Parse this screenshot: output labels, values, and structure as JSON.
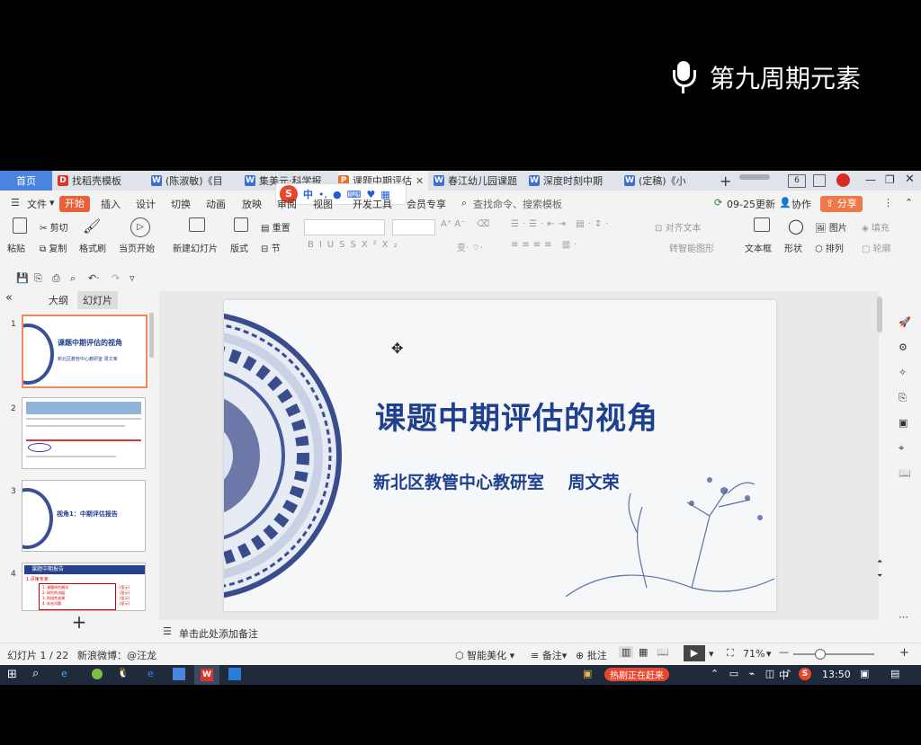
{
  "overlay": {
    "title": "第九周期元素"
  },
  "tabs": {
    "home": "首页",
    "items": [
      {
        "label": "找稻壳模板"
      },
      {
        "label": "(陈淑敏)《目"
      },
      {
        "label": "集美元·科学报"
      },
      {
        "label": "课题中期评估"
      },
      {
        "label": "春江幼儿园课题"
      },
      {
        "label": "深度时刻中期"
      },
      {
        "label": "(定稿)《小"
      }
    ],
    "new_tab": "+",
    "window_badge": "6"
  },
  "menu": {
    "file": "文件",
    "start": "开始",
    "items": [
      "插入",
      "设计",
      "切换",
      "动画",
      "放映",
      "审阅",
      "视图",
      "开发工具",
      "会员专享"
    ],
    "search_placeholder": "查找命令、搜索模板",
    "update": "09-25更新",
    "collab": "协作",
    "share": "分享"
  },
  "ime": {
    "label": "中"
  },
  "ribbon": {
    "paste": "粘贴",
    "cut": "剪切",
    "copy": "复制",
    "format_painter": "格式刷",
    "from_current": "当页开始",
    "new_slide": "新建幻灯片",
    "layout": "版式",
    "reset": "重置",
    "section": "节",
    "align_text": "对齐文本",
    "smartart": "转智能图形",
    "textbox": "文本框",
    "shape": "形状",
    "picture": "图片",
    "arrange": "排列",
    "fill": "填充",
    "outline": "轮廓"
  },
  "left_panel": {
    "tab_outline": "大纲",
    "tab_slides": "幻灯片",
    "add": "+"
  },
  "thumbs": [
    {
      "num": "1",
      "title": "课题中期评估的视角",
      "sub": "新北区教管中心教研室  周文荣"
    },
    {
      "num": "2"
    },
    {
      "num": "3",
      "title": "视角1：中期评估报告"
    },
    {
      "num": "4",
      "title": "课题中期报告",
      "label": "1.",
      "heading": "评审专家",
      "items": [
        "1. 课题研究概况",
        "2. 研究的进展",
        "3. 阶段性成果",
        "4. 存在问题"
      ],
      "tags": [
        "(显示)",
        "(显示)",
        "(显示)",
        "(显示)"
      ]
    }
  ],
  "slide": {
    "title": "课题中期评估的视角",
    "subtitle": "新北区教管中心教研室    周文荣"
  },
  "notes": {
    "placeholder": "单击此处添加备注"
  },
  "status": {
    "slide_count": "幻灯片 1 / 22",
    "theme": "新浪微博：@汪龙",
    "beautify": "智能美化",
    "notes": "备注",
    "comments": "批注",
    "zoom": "71%",
    "zoom_percent": 71
  },
  "taskbar": {
    "time": "13:50",
    "ime": "中",
    "promo": "热剧正在赶来"
  },
  "colors": {
    "accent": "#4a84e0",
    "start_btn": "#e8613a",
    "share_btn": "#f0794a",
    "title_blue": "#1f3f8f"
  }
}
